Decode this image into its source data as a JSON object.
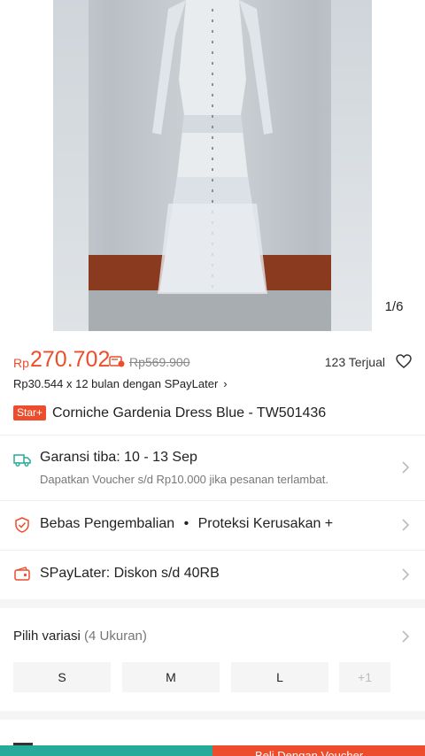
{
  "gallery": {
    "counter": "1/6"
  },
  "price": {
    "currency": "Rp",
    "current": "270.702",
    "original": "Rp569.900",
    "sold": "123 Terjual",
    "color": "#ee4d2d"
  },
  "spaylater_line": {
    "text": "Rp30.544 x 12 bulan dengan SPayLater",
    "chevron": "›"
  },
  "product": {
    "badge": "Star+",
    "title": "Corniche Gardenia Dress Blue - TW501436"
  },
  "shipping": {
    "icon": "truck-icon",
    "title": "Garansi tiba: 10 - 13 Sep",
    "subtitle": "Dapatkan Voucher s/d Rp10.000 jika pesanan terlambat."
  },
  "protection": {
    "icon": "shield-icon",
    "title": "Bebas Pengembalian",
    "bullet": "•",
    "extra": "Proteksi Kerusakan +"
  },
  "spaylater": {
    "icon": "wallet-icon",
    "title": "SPayLater: Diskon s/d 40RB"
  },
  "variation": {
    "label": "Pilih variasi",
    "count": "(4 Ukuran)",
    "options": [
      "S",
      "M",
      "L",
      "+1"
    ]
  },
  "bottom_bar": {
    "buy_label": "Beli Dengan Voucher"
  }
}
